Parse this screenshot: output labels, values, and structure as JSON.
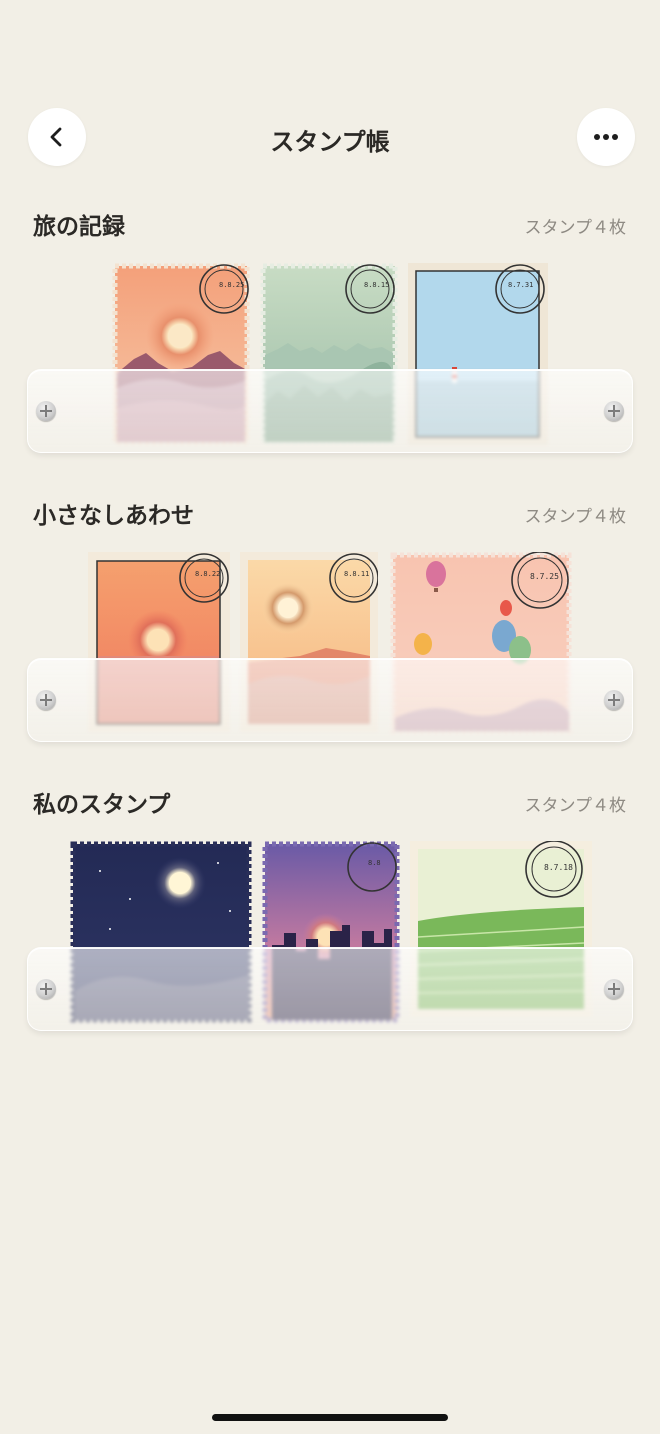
{
  "header": {
    "title": "スタンプ帳",
    "back_icon": "chevron-left-icon",
    "more_icon": "ellipsis-icon"
  },
  "sections": [
    {
      "title": "旅の記録",
      "count": "スタンプ４枚",
      "stamps": [
        {
          "theme": "mountain-sunset",
          "date": "8.8.25"
        },
        {
          "theme": "misty-mountains",
          "date": "8.8.15"
        },
        {
          "theme": "lighthouse-sea",
          "date": "8.7.31"
        }
      ]
    },
    {
      "title": "小さなしあわせ",
      "count": "スタンプ４枚",
      "stamps": [
        {
          "theme": "sunset-framed",
          "date": "8.8.22"
        },
        {
          "theme": "desert-sunrise",
          "date": "8.8.11"
        },
        {
          "theme": "hot-air-balloons",
          "date": "8.7.25"
        }
      ]
    },
    {
      "title": "私のスタンプ",
      "count": "スタンプ４枚",
      "stamps": [
        {
          "theme": "night-moon",
          "date": ""
        },
        {
          "theme": "city-dusk",
          "date": "8.8"
        },
        {
          "theme": "green-fields",
          "date": "8.7.18"
        }
      ]
    }
  ],
  "colors": {
    "background": "#f2efe6",
    "text": "#2b2926",
    "muted": "#8e8a83"
  }
}
